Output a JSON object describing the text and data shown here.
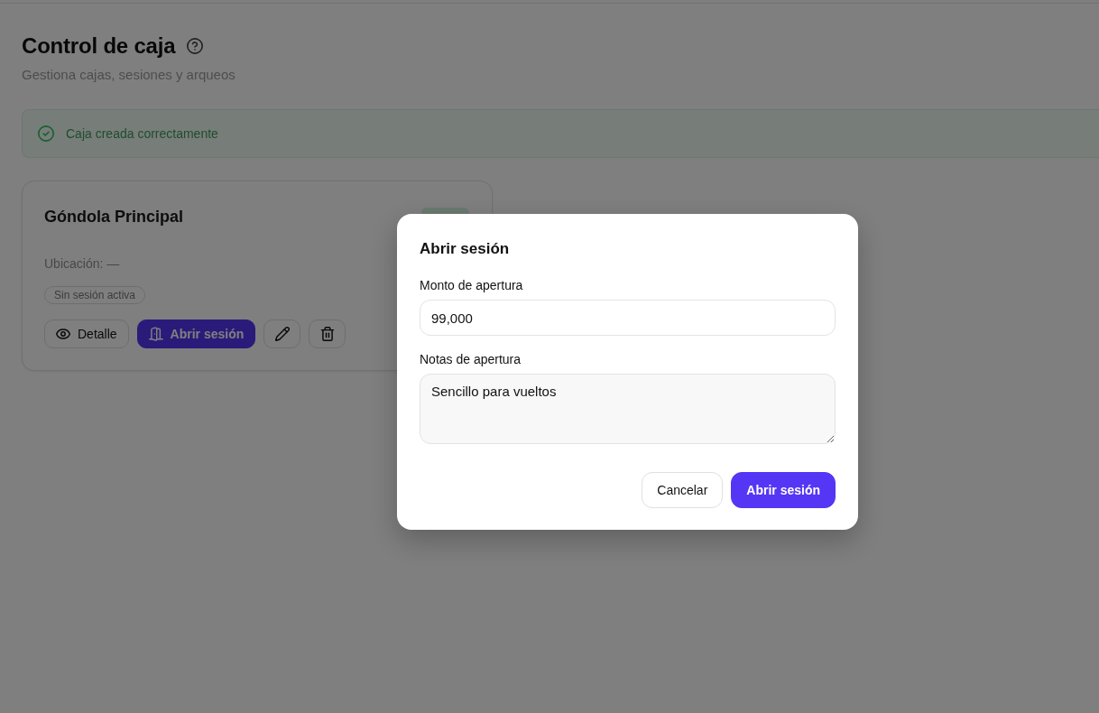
{
  "page": {
    "title": "Control de caja",
    "subtitle": "Gestiona cajas, sesiones y arqueos"
  },
  "alert": {
    "kind": "success",
    "message": "Caja creada correctamente"
  },
  "cards": [
    {
      "title": "Góndola Principal",
      "location": "Ubicación: —",
      "session": "Sin sesión activa",
      "actions": [
        {
          "kind": "view",
          "label": "Detalle",
          "primary": false
        },
        {
          "kind": "open",
          "label": "Abrir sesión",
          "primary": true
        },
        {
          "kind": "edit",
          "primary": false
        },
        {
          "kind": "delete",
          "primary": false
        }
      ]
    }
  ],
  "dialog": {
    "title": "Abrir sesión",
    "fields": [
      {
        "kind": "input",
        "label": "Monto de apertura",
        "value": "99,000"
      },
      {
        "kind": "textarea",
        "label": "Notas de apertura",
        "value": "Sencillo para vueltos"
      }
    ],
    "buttons": [
      {
        "label": "Cancelar",
        "primary": false
      },
      {
        "label": "Abrir sesión",
        "primary": true
      }
    ]
  }
}
